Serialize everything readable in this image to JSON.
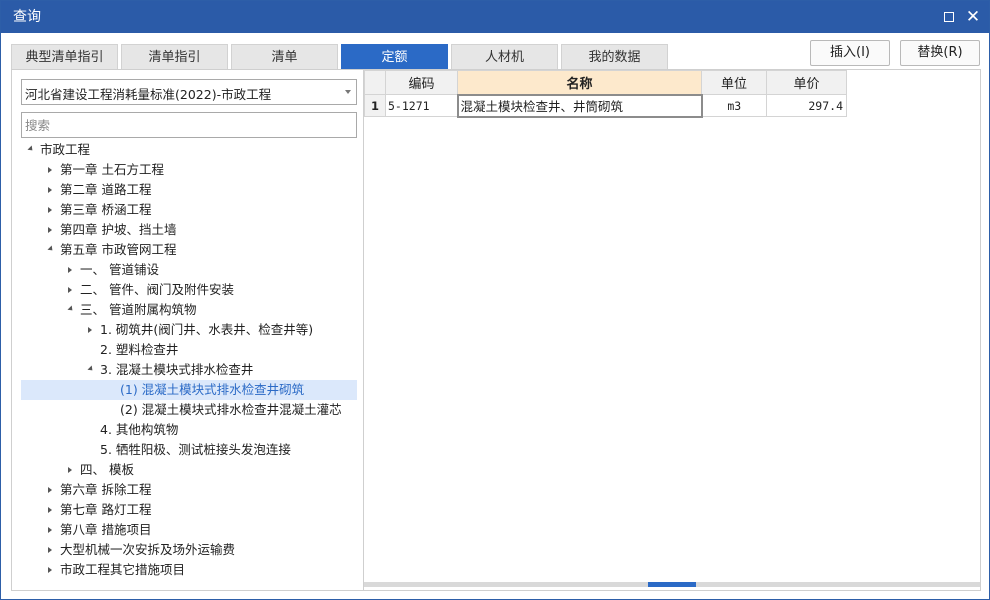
{
  "window": {
    "title": "查询",
    "max_icon": "maximize-icon",
    "close_icon": "close-icon"
  },
  "tabs": [
    {
      "label": "典型清单指引",
      "active": false
    },
    {
      "label": "清单指引",
      "active": false
    },
    {
      "label": "清单",
      "active": false
    },
    {
      "label": "定额",
      "active": true
    },
    {
      "label": "人材机",
      "active": false
    },
    {
      "label": "我的数据",
      "active": false
    }
  ],
  "buttons": {
    "insert": "插入(I)",
    "replace": "替换(R)"
  },
  "left": {
    "library": "河北省建设工程消耗量标准(2022)-市政工程",
    "search_placeholder": "搜索",
    "tree": [
      {
        "label": "市政工程",
        "level": 0,
        "expand": "down"
      },
      {
        "label": "第一章 土石方工程",
        "level": 1,
        "expand": "right"
      },
      {
        "label": "第二章 道路工程",
        "level": 1,
        "expand": "right"
      },
      {
        "label": "第三章 桥涵工程",
        "level": 1,
        "expand": "right"
      },
      {
        "label": "第四章 护坡、挡土墙",
        "level": 1,
        "expand": "right"
      },
      {
        "label": "第五章 市政管网工程",
        "level": 1,
        "expand": "down"
      },
      {
        "label": "一、 管道铺设",
        "level": 2,
        "expand": "right"
      },
      {
        "label": "二、 管件、阀门及附件安装",
        "level": 2,
        "expand": "right"
      },
      {
        "label": "三、 管道附属构筑物",
        "level": 2,
        "expand": "down"
      },
      {
        "label": "1. 砌筑井(阀门井、水表井、检查井等)",
        "level": 3,
        "expand": "right"
      },
      {
        "label": "2. 塑料检查井",
        "level": 3,
        "expand": "none"
      },
      {
        "label": "3. 混凝土模块式排水检查井",
        "level": 3,
        "expand": "down"
      },
      {
        "label": "(1) 混凝土模块式排水检查井砌筑",
        "level": 4,
        "expand": "none",
        "selected": true
      },
      {
        "label": "(2) 混凝土模块式排水检查井混凝土灌芯",
        "level": 4,
        "expand": "none"
      },
      {
        "label": "4. 其他构筑物",
        "level": 3,
        "expand": "none"
      },
      {
        "label": "5. 牺牲阳极、测试桩接头发泡连接",
        "level": 3,
        "expand": "none"
      },
      {
        "label": "四、 模板",
        "level": 2,
        "expand": "right"
      },
      {
        "label": "第六章 拆除工程",
        "level": 1,
        "expand": "right"
      },
      {
        "label": "第七章 路灯工程",
        "level": 1,
        "expand": "right"
      },
      {
        "label": "第八章 措施项目",
        "level": 1,
        "expand": "right"
      },
      {
        "label": "大型机械一次安拆及场外运输费",
        "level": 1,
        "expand": "right"
      },
      {
        "label": "市政工程其它措施项目",
        "level": 1,
        "expand": "right"
      }
    ]
  },
  "grid": {
    "headers": {
      "code": "编码",
      "name": "名称",
      "unit": "单位",
      "price": "单价"
    },
    "rows": [
      {
        "num": "1",
        "code": "5-1271",
        "name": "混凝土模块检查井、井筒砌筑",
        "unit": "m3",
        "price": "297.4"
      }
    ]
  },
  "scroll": {
    "label": "1"
  }
}
